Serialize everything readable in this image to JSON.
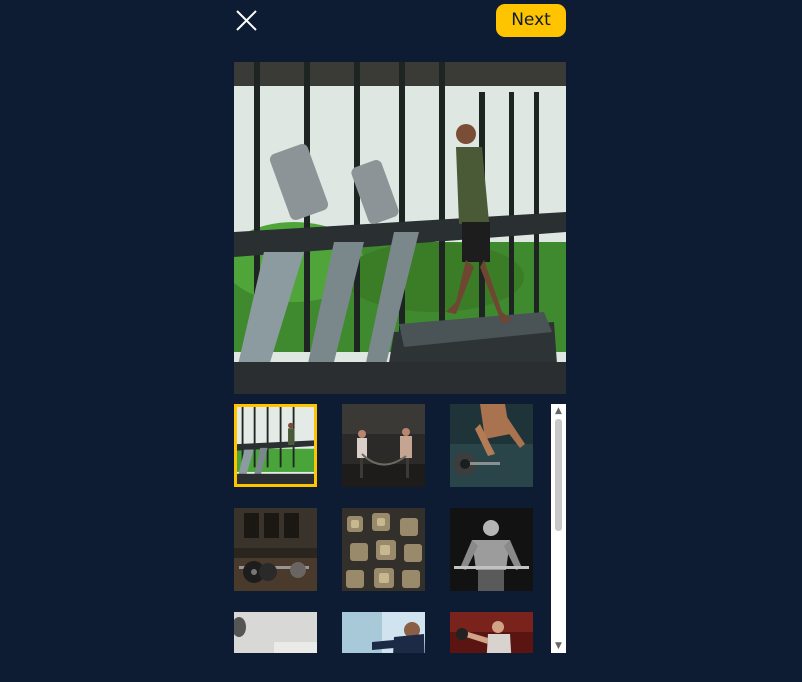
{
  "header": {
    "close_icon": "close-icon",
    "next_label": "Next",
    "accent_color": "#ffc400",
    "background_color": "#0e1c33"
  },
  "preview": {
    "subject": "treadmill-runner-photo"
  },
  "gallery": {
    "selected_index": 0,
    "thumbnails": [
      {
        "subject": "treadmill-runner-photo"
      },
      {
        "subject": "battle-ropes-photo"
      },
      {
        "subject": "sprinter-start-photo"
      },
      {
        "subject": "barbell-floor-photo"
      },
      {
        "subject": "dumbbell-rack-photo"
      },
      {
        "subject": "bodybuilder-bw-photo"
      },
      {
        "subject": "white-gym-photo"
      },
      {
        "subject": "boxer-training-photo"
      },
      {
        "subject": "kettlebell-woman-photo"
      }
    ]
  },
  "scrollbar": {
    "up_icon": "scroll-up-icon",
    "down_icon": "scroll-down-icon"
  }
}
